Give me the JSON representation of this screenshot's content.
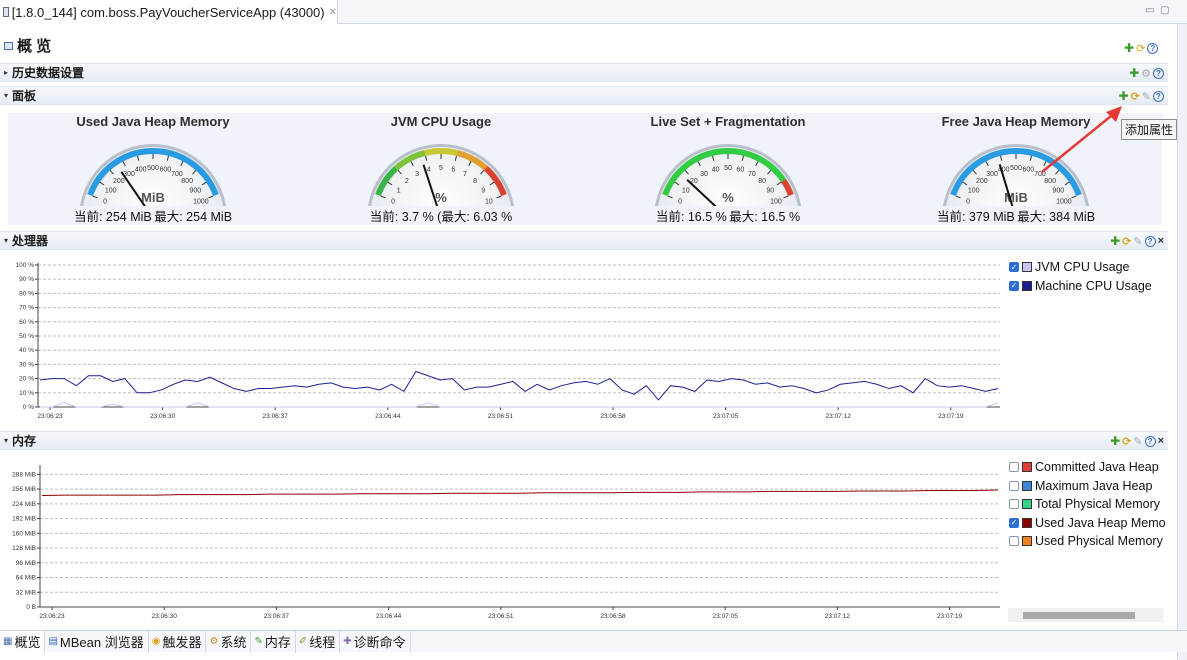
{
  "editor_tab": {
    "title": "[1.8.0_144] com.boss.PayVoucherServiceApp (43000)"
  },
  "overview": {
    "title": "概 览"
  },
  "sections": {
    "history": "历史数据设置",
    "dashboard": "面板",
    "processor": "处理器",
    "memory": "内存"
  },
  "tooltip": "添加属性",
  "gauges": [
    {
      "title": "Used Java Heap Memory",
      "unit": "MiB",
      "footer": "当前: 254 MiB 最大: 254 MiB",
      "value": 254,
      "max": 1000,
      "ticks": [
        "0",
        "100",
        "200",
        "300",
        "400",
        "500",
        "600",
        "700",
        "800",
        "900",
        "1000"
      ],
      "arc_color": "#2a9be0"
    },
    {
      "title": "JVM CPU Usage",
      "unit": "%",
      "footer": "当前: 3.7 % (最大: 6.03 %",
      "value": 3.7,
      "max": 10,
      "ticks": [
        "0",
        "1",
        "2",
        "3",
        "4",
        "5",
        "6",
        "7",
        "8",
        "9",
        "10"
      ],
      "arc_color": "gradient"
    },
    {
      "title": "Live Set + Fragmentation",
      "unit": "%",
      "footer": "当前: 16.5 % 最大: 16.5 %",
      "value": 16.5,
      "max": 100,
      "ticks": [
        "0",
        "10",
        "20",
        "30",
        "40",
        "50",
        "60",
        "70",
        "80",
        "90",
        "100"
      ],
      "arc_color": "#33cc44"
    },
    {
      "title": "Free Java Heap Memory",
      "unit": "MiB",
      "footer": "当前: 379 MiB 最大: 384 MiB",
      "value": 379,
      "max": 1000,
      "ticks": [
        "0",
        "100",
        "200",
        "300",
        "400",
        "500",
        "600",
        "700",
        "800",
        "900",
        "1000"
      ],
      "arc_color": "#2a9be0"
    }
  ],
  "chart_data": [
    {
      "type": "line",
      "title": "处理器",
      "x": [
        "23:06:23",
        "23:06:30",
        "23:06:37",
        "23:06:44",
        "23:06:51",
        "23:06:58",
        "23:07:05",
        "23:07:12",
        "23:07:19"
      ],
      "y_ticks": [
        "0 %",
        "10 %",
        "20 %",
        "30 %",
        "40 %",
        "50 %",
        "60 %",
        "70 %",
        "80 %",
        "90 %",
        "100 %"
      ],
      "ylim": [
        0,
        100
      ],
      "series": [
        {
          "name": "JVM CPU Usage",
          "color": "#c9c5f0",
          "checked": true,
          "values": [
            0,
            0,
            3,
            0,
            0,
            0,
            2,
            0,
            0,
            0,
            0,
            0,
            0,
            3,
            0,
            0,
            0,
            0,
            0,
            0,
            0,
            0,
            0,
            0,
            0,
            0,
            0,
            0,
            0,
            0,
            0,
            0,
            3,
            0,
            0,
            0,
            0,
            0,
            0,
            0,
            0,
            0,
            0,
            0,
            0,
            0,
            0,
            0,
            0,
            0,
            0,
            0,
            0,
            0,
            0,
            0,
            0,
            0,
            0,
            0,
            0,
            0,
            0,
            0,
            0,
            0,
            0,
            0,
            0,
            0,
            0,
            0,
            0,
            0,
            0,
            0,
            0,
            0,
            0,
            3
          ]
        },
        {
          "name": "Machine CPU Usage",
          "color": "#1d1f8f",
          "checked": true,
          "values": [
            19,
            20,
            20,
            15,
            22,
            22,
            18,
            20,
            10,
            10,
            12,
            16,
            19,
            18,
            21,
            17,
            13,
            11,
            13,
            13,
            14,
            15,
            14,
            16,
            17,
            14,
            13,
            14,
            12,
            16,
            11,
            25,
            22,
            19,
            20,
            12,
            14,
            14,
            16,
            18,
            11,
            16,
            12,
            15,
            17,
            18,
            16,
            20,
            12,
            9,
            15,
            5,
            15,
            14,
            11,
            19,
            18,
            20,
            19,
            16,
            17,
            14,
            15,
            13,
            10,
            12,
            16,
            17,
            18,
            16,
            13,
            15,
            10,
            20,
            15,
            14,
            15,
            13,
            11,
            13
          ]
        }
      ]
    },
    {
      "type": "line",
      "title": "内存",
      "x": [
        "23:06:23",
        "23:06:30",
        "23:06:37",
        "23:06:44",
        "23:06:51",
        "23:06:58",
        "23:07:05",
        "23:07:12",
        "23:07:19"
      ],
      "y_ticks": [
        "0 B",
        "32 MiB",
        "64 MiB",
        "96 MiB",
        "128 MiB",
        "160 MiB",
        "192 MiB",
        "224 MiB",
        "256 MiB",
        "288 MiB"
      ],
      "ylim": [
        0,
        304
      ],
      "series": [
        {
          "name": "Committed Java Heap",
          "color": "#e03c3c",
          "checked": false,
          "values": []
        },
        {
          "name": "Maximum Java Heap",
          "color": "#3d86d8",
          "checked": false,
          "values": []
        },
        {
          "name": "Total Physical Memory",
          "color": "#3ccf8a",
          "checked": false,
          "values": []
        },
        {
          "name": "Used Java Heap Memo",
          "color": "#8b0000",
          "checked": true,
          "values": [
            242,
            243,
            243,
            243,
            243,
            243,
            244,
            244,
            244,
            244,
            245,
            245,
            245,
            245,
            246,
            246,
            246,
            246,
            247,
            247,
            247,
            247,
            248,
            248,
            248,
            248,
            249,
            249,
            249,
            250,
            250,
            250,
            251,
            251,
            251,
            251,
            252,
            252,
            252,
            253,
            253,
            253,
            254
          ]
        },
        {
          "name": "Used Physical Memory",
          "color": "#f08020",
          "checked": false,
          "values": []
        }
      ]
    }
  ],
  "bottom_tabs": [
    {
      "label": "概览",
      "icon": "overview-icon",
      "color": "#4a6fb0"
    },
    {
      "label": "MBean 浏览器",
      "icon": "mbean-icon",
      "color": "#3a6ac8"
    },
    {
      "label": "触发器",
      "icon": "trigger-icon",
      "color": "#e0a020"
    },
    {
      "label": "系统",
      "icon": "system-icon",
      "color": "#c98a20"
    },
    {
      "label": "内存",
      "icon": "memory-icon",
      "color": "#3a9a3a"
    },
    {
      "label": "线程",
      "icon": "thread-icon",
      "color": "#7a9a2a"
    },
    {
      "label": "诊断命令",
      "icon": "diagnostic-icon",
      "color": "#8a6ab0"
    }
  ]
}
